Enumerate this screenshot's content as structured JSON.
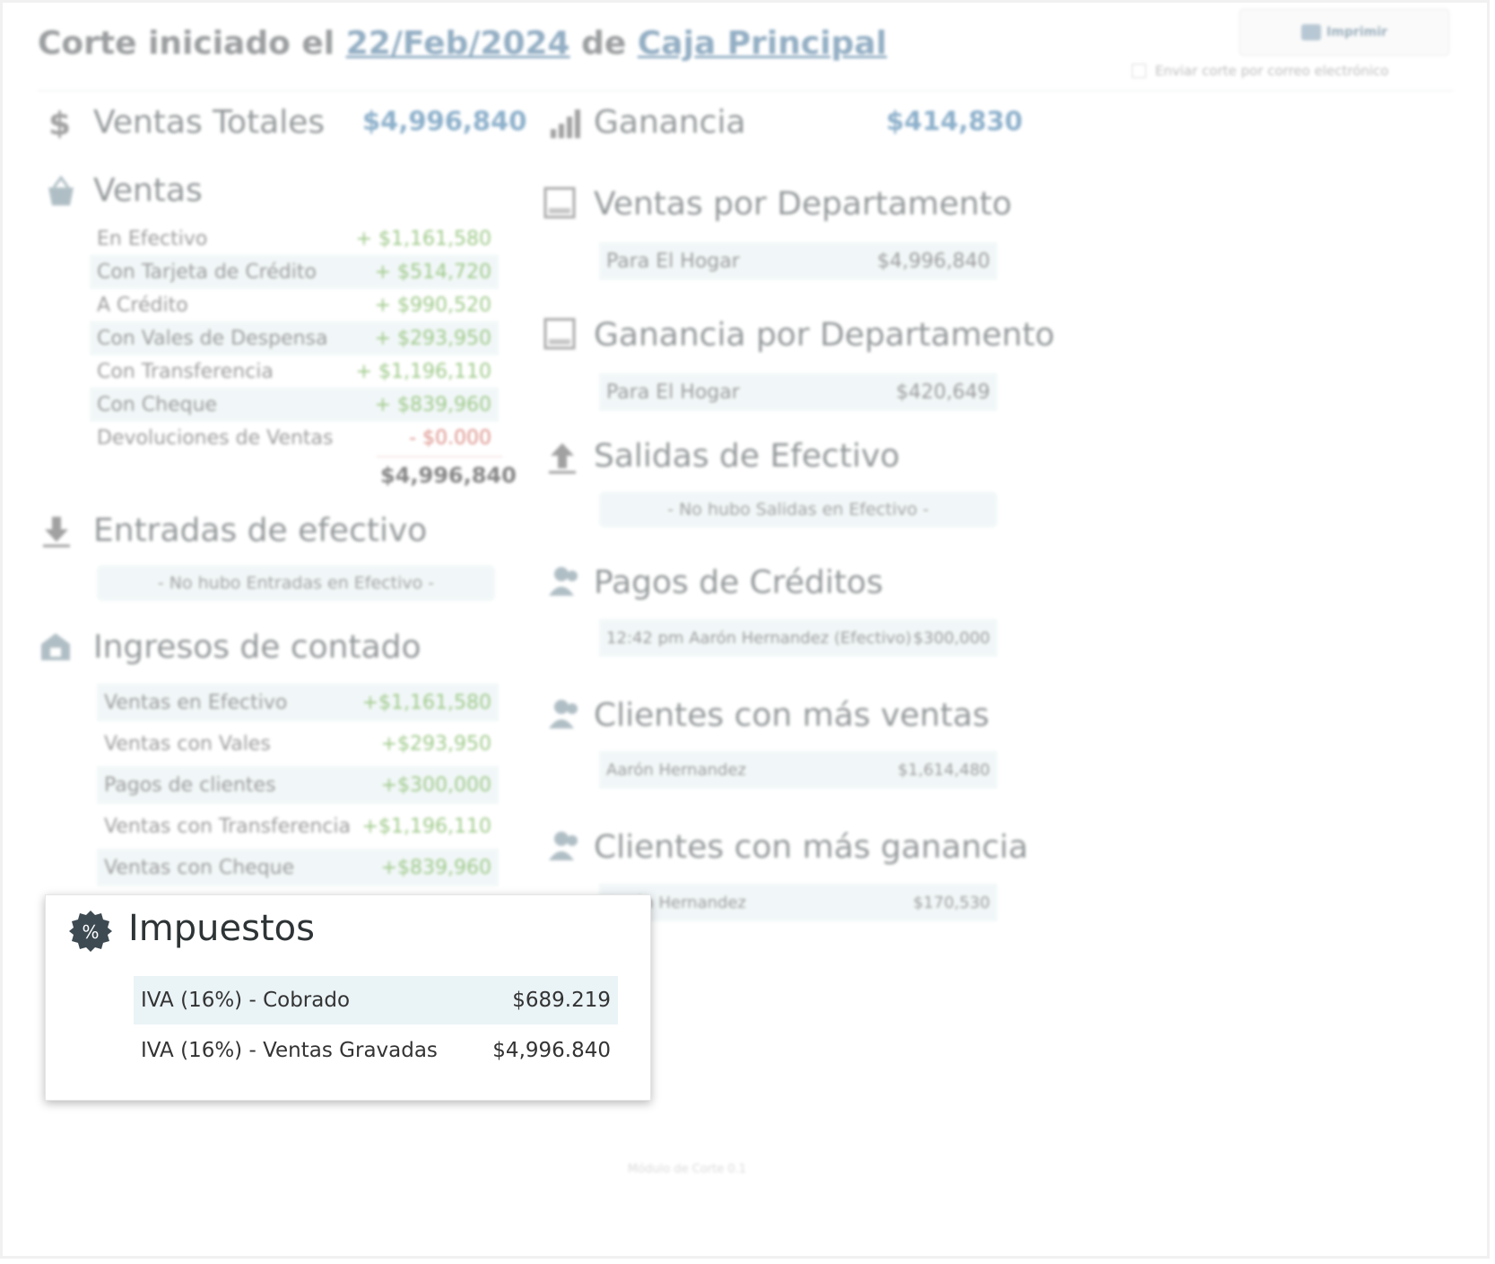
{
  "header": {
    "prefix": "Corte iniciado el",
    "date": "22/Feb/2024",
    "middle": "de",
    "register": "Caja Principal"
  },
  "actions": {
    "print_label": "Imprimir",
    "email_label": "Enviar corte por correo electrónico"
  },
  "summary": {
    "ventas_totales_label": "Ventas Totales",
    "ventas_totales_value": "$4,996,840",
    "ganancia_label": "Ganancia",
    "ganancia_value": "$414,830"
  },
  "ventas": {
    "title": "Ventas",
    "rows": [
      {
        "label": "En Efectivo",
        "value": "+ $1,161,580"
      },
      {
        "label": "Con Tarjeta de Crédito",
        "value": "+ $514,720"
      },
      {
        "label": "A Crédito",
        "value": "+ $990,520"
      },
      {
        "label": "Con Vales de Despensa",
        "value": "+ $293,950"
      },
      {
        "label": "Con Transferencia",
        "value": "+ $1,196,110"
      },
      {
        "label": "Con Cheque",
        "value": "+ $839,960"
      },
      {
        "label": "Devoluciones de Ventas",
        "value": "- $0.000"
      }
    ],
    "total": "$4,996,840"
  },
  "entradas": {
    "title": "Entradas de efectivo",
    "empty": "- No hubo Entradas en Efectivo -"
  },
  "ingresos": {
    "title": "Ingresos de contado",
    "rows": [
      {
        "label": "Ventas en Efectivo",
        "value": "+$1,161,580"
      },
      {
        "label": "Ventas con Vales",
        "value": "+$293,950"
      },
      {
        "label": "Pagos de clientes",
        "value": "+$300,000"
      },
      {
        "label": "Ventas con Transferencia",
        "value": "+$1,196,110"
      },
      {
        "label": "Ventas con Cheque",
        "value": "+$839,960"
      }
    ]
  },
  "ventas_depto": {
    "title": "Ventas por Departamento",
    "rows": [
      {
        "label": "Para El Hogar",
        "value": "$4,996,840"
      }
    ]
  },
  "ganancia_depto": {
    "title": "Ganancia por Departamento",
    "rows": [
      {
        "label": "Para El Hogar",
        "value": "$420,649"
      }
    ]
  },
  "salidas": {
    "title": "Salidas de Efectivo",
    "empty": "- No hubo Salidas en Efectivo -"
  },
  "pagos_creditos": {
    "title": "Pagos de Créditos",
    "rows": [
      {
        "label": "12:42 pm Aarón Hernandez (Efectivo)",
        "value": "$300,000"
      }
    ]
  },
  "clientes_ventas": {
    "title": "Clientes con más ventas",
    "rows": [
      {
        "label": "Aarón Hernandez",
        "value": "$1,614,480"
      }
    ]
  },
  "clientes_ganancia": {
    "title": "Clientes con más ganancia",
    "rows": [
      {
        "label": "Aarón Hernandez",
        "value": "$170,530"
      }
    ]
  },
  "impuestos": {
    "title": "Impuestos",
    "icon_glyph": "%",
    "rows": [
      {
        "label": "IVA (16%) - Cobrado",
        "value": "$689.219"
      },
      {
        "label": "IVA (16%) - Ventas Gravadas",
        "value": "$4,996.840"
      }
    ]
  },
  "footer": "Módulo de Corte 0.1",
  "colors": {
    "accent": "#2f6fa0",
    "positive": "#4f9d2a",
    "negative": "#c0392b",
    "row_bg": "#e7f1f3"
  }
}
